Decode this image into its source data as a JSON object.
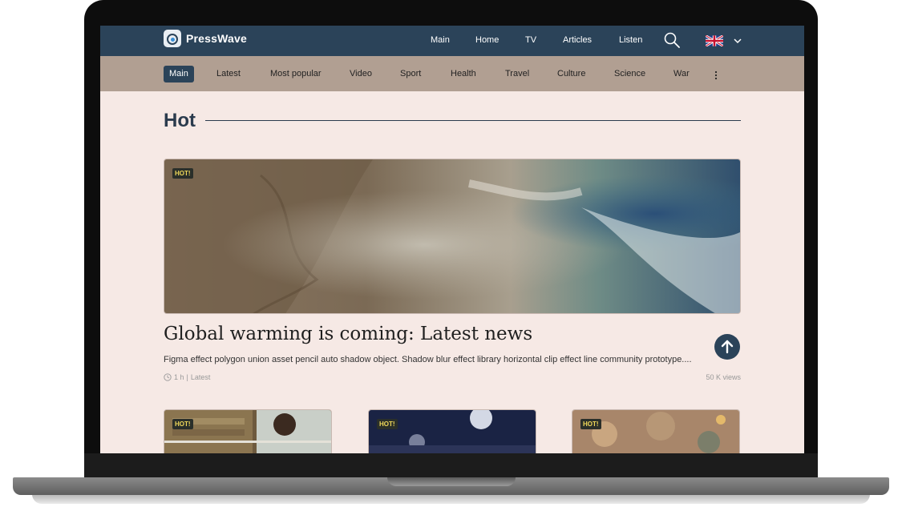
{
  "brand": {
    "name": "PressWave"
  },
  "main_nav": [
    "Main",
    "Home",
    "TV",
    "Articles",
    "Listen"
  ],
  "categories": [
    "Main",
    "Latest",
    "Most popular",
    "Video",
    "Sport",
    "Health",
    "Travel",
    "Culture",
    "Science",
    "War"
  ],
  "active_category": "Main",
  "section": {
    "title": "Hot"
  },
  "hero": {
    "badge": "HOT!",
    "headline": "Global warming is coming: Latest news",
    "summary": "Figma effect polygon union asset pencil auto shadow object. Shadow blur effect library horizontal clip effect line community prototype....",
    "time": "1 h",
    "category": "Latest",
    "views": "50 K views"
  },
  "cards": [
    {
      "badge": "HOT!"
    },
    {
      "badge": "HOT!"
    },
    {
      "badge": "HOT!"
    }
  ],
  "icons": {
    "search": "search-icon",
    "flag": "uk-flag-icon",
    "language": "chevron-down-icon",
    "more": "more-vertical-icon",
    "up": "arrow-up-icon",
    "clock": "clock-icon"
  },
  "colors": {
    "header": "#2b4359",
    "category_bar": "#b19f92",
    "page_bg": "#f6e9e5",
    "badge_text": "#f0d85a"
  }
}
